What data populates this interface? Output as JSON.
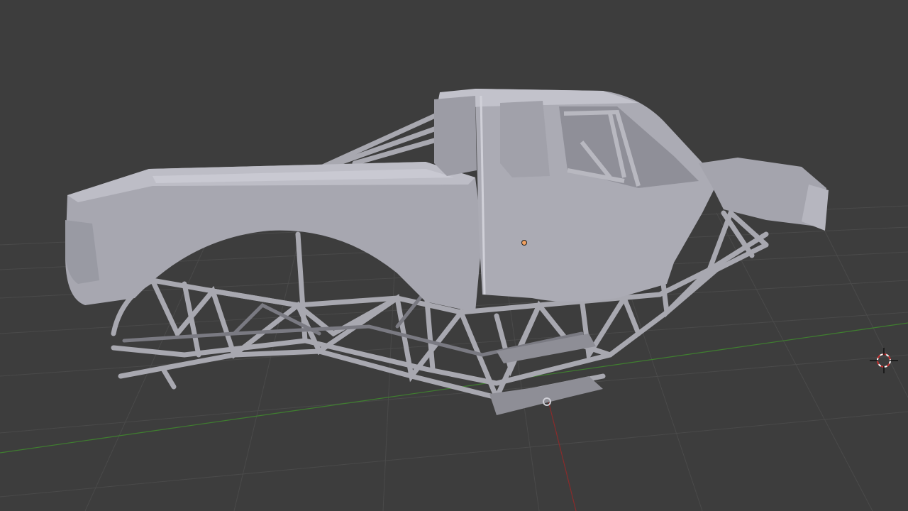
{
  "viewport": {
    "background": "#3d3d3d",
    "grid_color": "#4a4a4a",
    "x_axis_color": "#8a2b2b",
    "y_axis_color": "#3f7f2f"
  },
  "model": {
    "name": "monster-truck-body-with-tube-chassis",
    "body_color": "#a9a9b2",
    "body_shadow": "#8c8c96",
    "frame_color": "#b0b0b8",
    "frame_shadow": "#6f6f77"
  },
  "origin": {
    "color": "#f0a060"
  },
  "cursor_3d": {
    "icon": "3d-cursor-icon",
    "ring_color": "#cc3333"
  }
}
